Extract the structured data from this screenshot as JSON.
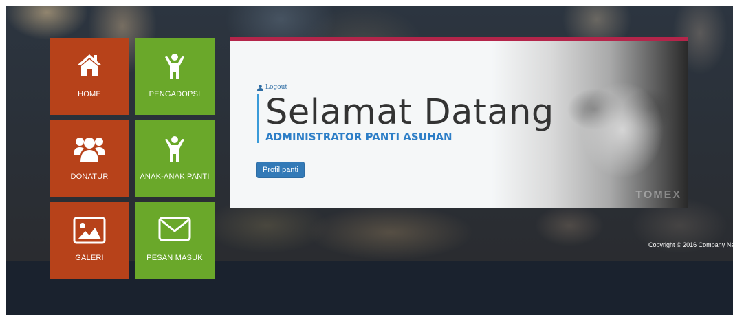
{
  "tiles": [
    {
      "label": "HOME",
      "icon": "home-icon",
      "color": "#b7421a"
    },
    {
      "label": "PENGADOPSI",
      "icon": "child-icon",
      "color": "#6aa82a"
    },
    {
      "label": "DONATUR",
      "icon": "users-icon",
      "color": "#b7421a"
    },
    {
      "label": "ANAK-ANAK PANTI",
      "icon": "child-icon",
      "color": "#6aa82a"
    },
    {
      "label": "GALERI",
      "icon": "image-icon",
      "color": "#b7421a"
    },
    {
      "label": "PESAN MASUK",
      "icon": "envelope-icon",
      "color": "#6aa82a"
    }
  ],
  "panel": {
    "logout_label": "Logout",
    "title": "Selamat Datang",
    "subtitle": "ADMINISTRATOR PANTI ASUHAN",
    "button_label": "Profil panti",
    "watermark": "TOMEX"
  },
  "footer": {
    "copyright": "Copyright © 2016 Company Na"
  },
  "colors": {
    "accent_red": "#b7421a",
    "accent_green": "#6aa82a",
    "panel_top": "#b4254a",
    "primary": "#337ab7"
  }
}
